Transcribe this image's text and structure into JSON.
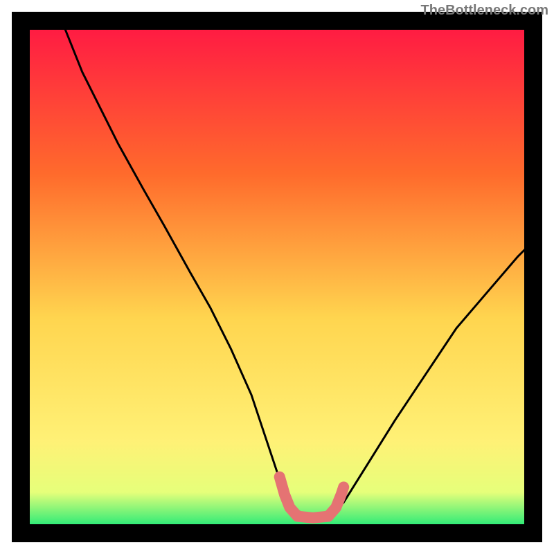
{
  "watermark": "TheBottleneck.com",
  "chart_data": {
    "type": "line",
    "title": "",
    "xlabel": "",
    "ylabel": "",
    "xlim": [
      0,
      100
    ],
    "ylim": [
      0,
      100
    ],
    "background_gradient": {
      "top": "#FF1744",
      "mid_upper": "#FF6B2C",
      "mid": "#FFD54F",
      "mid_lower": "#FFF176",
      "bottom": "#00E676"
    },
    "frame_color": "#000000",
    "curve": {
      "x": [
        8,
        12,
        16,
        19,
        24,
        28,
        33,
        37,
        41,
        45,
        48,
        50,
        53,
        56.5,
        60,
        63,
        68,
        73,
        79,
        85,
        91,
        97,
        100
      ],
      "y": [
        100,
        90,
        82,
        76,
        67,
        60,
        51,
        44,
        36,
        27,
        18,
        12,
        5,
        3,
        3,
        6,
        14,
        22,
        31,
        40,
        47,
        54,
        57
      ]
    },
    "marker_segment": {
      "color": "#E57373",
      "points_x": [
        50.5,
        51.5,
        52.5,
        54,
        57,
        60,
        61.5,
        62.5,
        63
      ],
      "points_y": [
        11,
        7.5,
        5,
        3.3,
        3,
        3.3,
        5,
        7.5,
        9
      ]
    }
  }
}
